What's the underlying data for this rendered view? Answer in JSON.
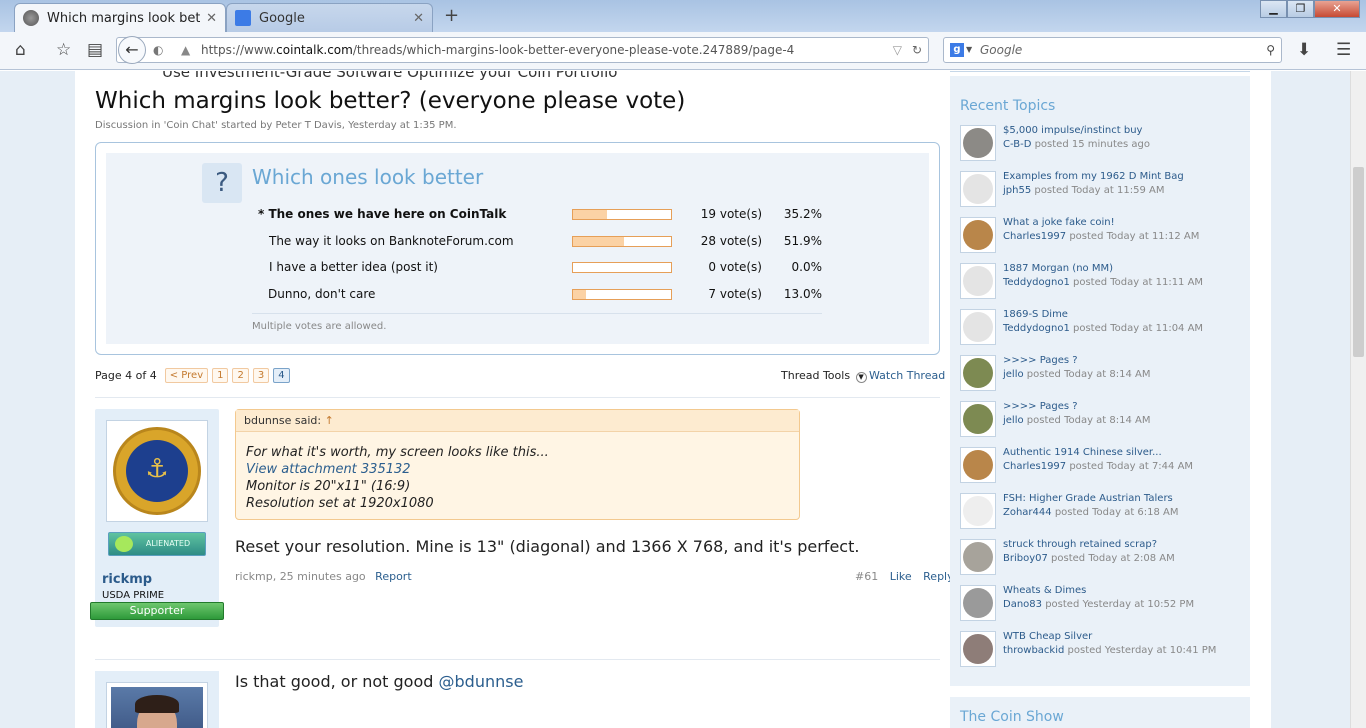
{
  "browser": {
    "tabs": [
      {
        "label": "Which margins look better...",
        "active": true
      },
      {
        "label": "Google",
        "active": false
      }
    ],
    "new_tab": "+",
    "url_prefix": "https://www.",
    "url_domain": "cointalk.com",
    "url_path": "/threads/which-margins-look-better-everyone-please-vote.247889/page-4",
    "search_placeholder": "Google",
    "search_engine_letter": "g"
  },
  "thread": {
    "ad_text": "Use Investment-Grade Software Optimize your Coin Portfolio",
    "title": "Which margins look better? (everyone please vote)",
    "description": "Discussion in 'Coin Chat' started by Peter T Davis, Yesterday at 1:35 PM."
  },
  "poll": {
    "icon": "?",
    "title": "Which ones look better",
    "options": [
      {
        "label": "* The ones we have here on CoinTalk",
        "votes": "19 vote(s)",
        "percent": "35.2%",
        "fraction": 0.352,
        "bold": true
      },
      {
        "label": "The way it looks on BanknoteForum.com",
        "votes": "28 vote(s)",
        "percent": "51.9%",
        "fraction": 0.519,
        "bold": false
      },
      {
        "label": "I have a better idea (post it)",
        "votes": "0 vote(s)",
        "percent": "0.0%",
        "fraction": 0.0,
        "bold": false
      },
      {
        "label": "Dunno, don't care",
        "votes": "7 vote(s)",
        "percent": "13.0%",
        "fraction": 0.13,
        "bold": false
      }
    ],
    "footer": "Multiple votes are allowed."
  },
  "pagination": {
    "label": "Page 4 of 4",
    "prev": "< Prev",
    "pages": [
      "1",
      "2",
      "3",
      "4"
    ],
    "current": "4",
    "thread_tools": "Thread Tools",
    "watch_thread": "Watch Thread"
  },
  "post1": {
    "username": "rickmp",
    "user_title": "USDA PRIME",
    "badge": "ALIENATED",
    "supporter": "Supporter",
    "quote_author": "bdunnse said:",
    "quote_arrow": "↑",
    "quote_lines": [
      "For what it's worth, my screen looks like this...",
      "View attachment 335132",
      "Monitor is 20\"x11\" (16:9)",
      "Resolution set at 1920x1080"
    ],
    "message": "Reset your resolution. Mine is 13\" (diagonal) and 1366 X 768, and it's perfect.",
    "meta": "rickmp, 25 minutes ago",
    "report": "Report",
    "post_number": "#61",
    "like": "Like",
    "reply": "Reply"
  },
  "post2": {
    "message_prefix": "Is that good, or not good ",
    "mention": "@bdunnse"
  },
  "sidebar": {
    "recent_title": "Recent Topics",
    "topics": [
      {
        "title": "$5,000 impulse/instinct buy",
        "user": "C-B-D",
        "when": " posted 15 minutes ago",
        "color": "#8c8a86"
      },
      {
        "title": "Examples from my 1962 D Mint Bag",
        "user": "jph55",
        "when": " posted Today at 11:59 AM",
        "color": "#e4e4e4"
      },
      {
        "title": "What a joke fake coin!",
        "user": "Charles1997",
        "when": " posted Today at 11:12 AM",
        "color": "#b9864a"
      },
      {
        "title": "1887 Morgan (no MM)",
        "user": "Teddydogno1",
        "when": " posted Today at 11:11 AM",
        "color": "#e4e4e4"
      },
      {
        "title": "1869-S Dime",
        "user": "Teddydogno1",
        "when": " posted Today at 11:04 AM",
        "color": "#e4e4e4"
      },
      {
        "title": ">>>> Pages ?",
        "user": "jello",
        "when": " posted Today at 8:14 AM",
        "color": "#7d8a52"
      },
      {
        "title": ">>>> Pages ?",
        "user": "jello",
        "when": " posted Today at 8:14 AM",
        "color": "#7d8a52"
      },
      {
        "title": "Authentic 1914 Chinese silver...",
        "user": "Charles1997",
        "when": " posted Today at 7:44 AM",
        "color": "#b9864a"
      },
      {
        "title": "FSH: Higher Grade Austrian Talers",
        "user": "Zohar444",
        "when": " posted Today at 6:18 AM",
        "color": "#eeeeee"
      },
      {
        "title": "struck through retained scrap?",
        "user": "Briboy07",
        "when": " posted Today at 2:08 AM",
        "color": "#a7a39b"
      },
      {
        "title": "Wheats & Dimes",
        "user": "Dano83",
        "when": " posted Yesterday at 10:52 PM",
        "color": "#9a9a9a"
      },
      {
        "title": "WTB Cheap Silver",
        "user": "throwbackid",
        "when": " posted Yesterday at 10:41 PM",
        "color": "#8e7d78"
      }
    ],
    "coin_show_title": "The Coin Show"
  }
}
